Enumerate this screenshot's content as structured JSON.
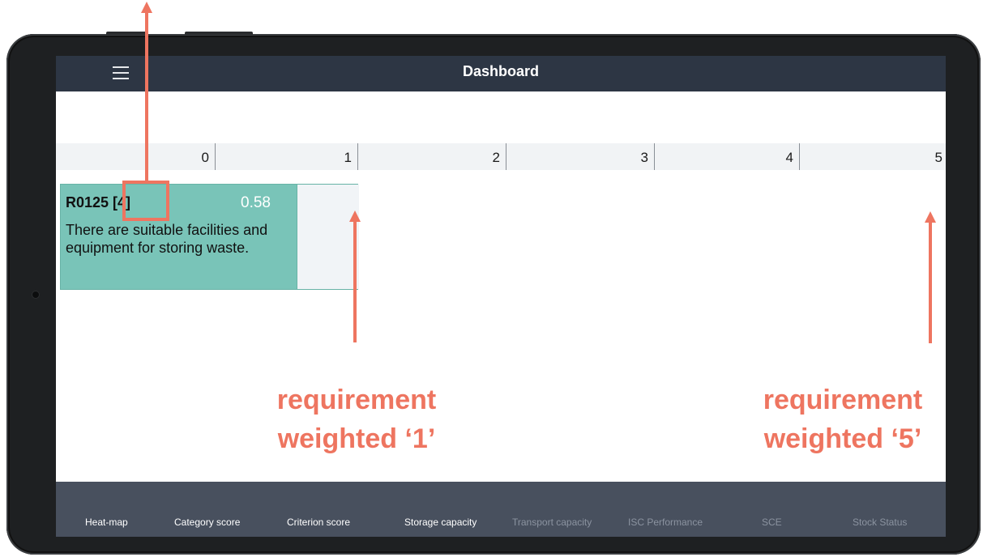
{
  "topbar": {
    "title": "Dashboard",
    "menu_icon": "hamburger-menu-icon"
  },
  "scale": {
    "ticks": [
      "0",
      "1",
      "2",
      "3",
      "4",
      "5"
    ]
  },
  "card": {
    "code": "R0125 [4]",
    "score": "0.58",
    "text": "There are suitable facilities and equipment for storing waste.",
    "color": "#79c4b8"
  },
  "tabs": [
    {
      "label": "Heat-map",
      "enabled": true
    },
    {
      "label": "Category score",
      "enabled": true
    },
    {
      "label": "Criterion score",
      "enabled": true
    },
    {
      "label": "Storage capacity",
      "enabled": true
    },
    {
      "label": "Transport capacity",
      "enabled": false
    },
    {
      "label": "ISC Performance",
      "enabled": false
    },
    {
      "label": "SCE",
      "enabled": false
    },
    {
      "label": "Stock Status",
      "enabled": false
    }
  ],
  "annotations": {
    "left": "requirement weighted ‘1’",
    "right": "requirement weighted ‘5’",
    "color": "#ee7560"
  }
}
